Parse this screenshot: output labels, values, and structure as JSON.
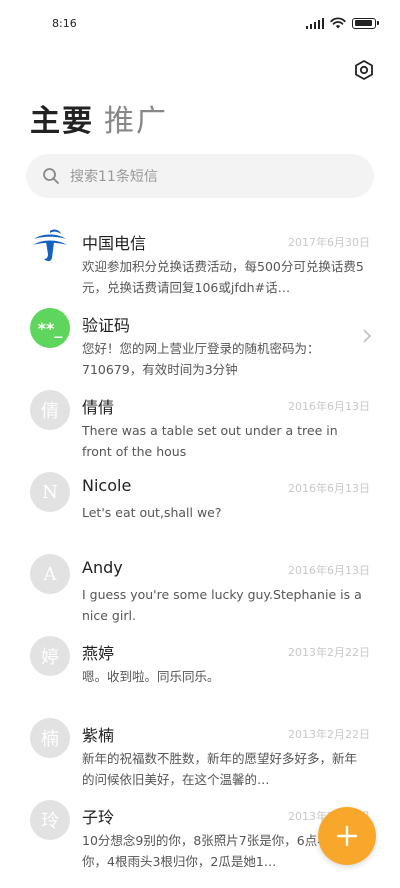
{
  "status_bar": {
    "time": "8:16"
  },
  "tabs": [
    {
      "label": "主要"
    },
    {
      "label": "推广"
    }
  ],
  "search": {
    "placeholder": "搜索11条短信"
  },
  "colors": {
    "fab": "#f9a72b",
    "verification_avatar": "#5ed65d",
    "telecom_logo": "#1660c0"
  },
  "messages": [
    {
      "name": "中国电信",
      "date": "2017年6月30日",
      "preview": "欢迎参加积分兑换话费活动，每500分可兑换话费5元，兑换话费请回复106或jfdh#话…",
      "avatar_icon": "china-telecom-logo-icon"
    },
    {
      "name": "验证码",
      "date": "",
      "preview": "您好！您的网上营业厅登录的随机密码为：710679，有效时间为3分钟",
      "avatar_text": "**_"
    },
    {
      "name": "倩倩",
      "date": "2016年6月13日",
      "preview": "There was a table set out under a tree in front of the hous",
      "avatar_text": "倩"
    },
    {
      "name": "Nicole",
      "date": "2016年6月13日",
      "preview": "Let's eat out,shall we?",
      "avatar_text": "N"
    },
    {
      "name": "Andy",
      "date": "2016年6月13日",
      "preview": "I guess you're some lucky guy.Stephanie is a nice girl.",
      "avatar_text": "A"
    },
    {
      "name": "燕婷",
      "date": "2013年2月22日",
      "preview": "嗯。收到啦。同乐同乐。",
      "avatar_text": "婷"
    },
    {
      "name": "紫楠",
      "date": "2013年2月22日",
      "preview": "新年的祝福数不胜数，新年的愿望好多好多，新年的问候依旧美好，在这个温馨的…",
      "avatar_text": "楠"
    },
    {
      "name": "子玲",
      "date": "2013年2月22日",
      "preview": "10分想念9别的你，8张照片7张是你，6点小树已像你，4根雨头3根归你，2瓜是她1…",
      "avatar_text": "玲"
    }
  ],
  "fab": {
    "label": "+"
  }
}
